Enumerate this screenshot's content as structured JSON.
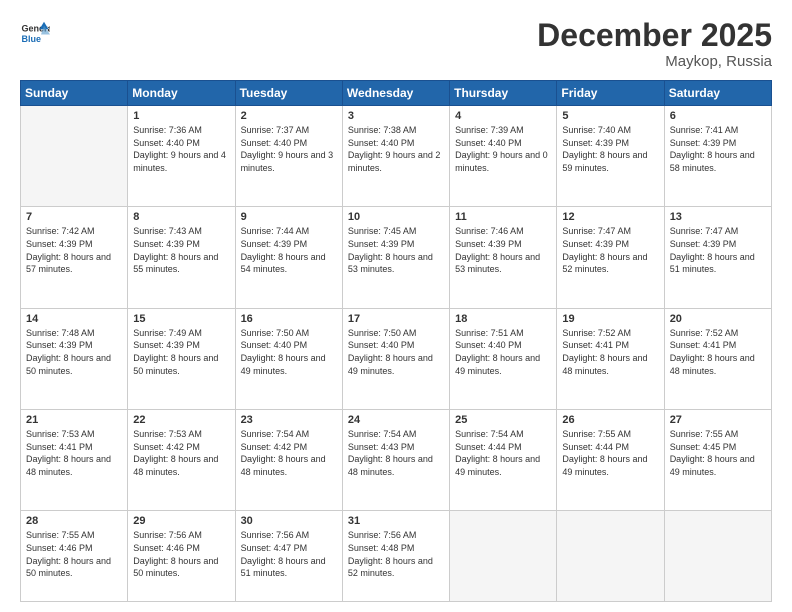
{
  "header": {
    "logo_general": "General",
    "logo_blue": "Blue",
    "month_title": "December 2025",
    "location": "Maykop, Russia"
  },
  "weekdays": [
    "Sunday",
    "Monday",
    "Tuesday",
    "Wednesday",
    "Thursday",
    "Friday",
    "Saturday"
  ],
  "weeks": [
    [
      {
        "day": "",
        "empty": true
      },
      {
        "day": "1",
        "sunrise": "7:36 AM",
        "sunset": "4:40 PM",
        "daylight": "9 hours and 4 minutes."
      },
      {
        "day": "2",
        "sunrise": "7:37 AM",
        "sunset": "4:40 PM",
        "daylight": "9 hours and 3 minutes."
      },
      {
        "day": "3",
        "sunrise": "7:38 AM",
        "sunset": "4:40 PM",
        "daylight": "9 hours and 2 minutes."
      },
      {
        "day": "4",
        "sunrise": "7:39 AM",
        "sunset": "4:40 PM",
        "daylight": "9 hours and 0 minutes."
      },
      {
        "day": "5",
        "sunrise": "7:40 AM",
        "sunset": "4:39 PM",
        "daylight": "8 hours and 59 minutes."
      },
      {
        "day": "6",
        "sunrise": "7:41 AM",
        "sunset": "4:39 PM",
        "daylight": "8 hours and 58 minutes."
      }
    ],
    [
      {
        "day": "7",
        "sunrise": "7:42 AM",
        "sunset": "4:39 PM",
        "daylight": "8 hours and 57 minutes."
      },
      {
        "day": "8",
        "sunrise": "7:43 AM",
        "sunset": "4:39 PM",
        "daylight": "8 hours and 55 minutes."
      },
      {
        "day": "9",
        "sunrise": "7:44 AM",
        "sunset": "4:39 PM",
        "daylight": "8 hours and 54 minutes."
      },
      {
        "day": "10",
        "sunrise": "7:45 AM",
        "sunset": "4:39 PM",
        "daylight": "8 hours and 53 minutes."
      },
      {
        "day": "11",
        "sunrise": "7:46 AM",
        "sunset": "4:39 PM",
        "daylight": "8 hours and 53 minutes."
      },
      {
        "day": "12",
        "sunrise": "7:47 AM",
        "sunset": "4:39 PM",
        "daylight": "8 hours and 52 minutes."
      },
      {
        "day": "13",
        "sunrise": "7:47 AM",
        "sunset": "4:39 PM",
        "daylight": "8 hours and 51 minutes."
      }
    ],
    [
      {
        "day": "14",
        "sunrise": "7:48 AM",
        "sunset": "4:39 PM",
        "daylight": "8 hours and 50 minutes."
      },
      {
        "day": "15",
        "sunrise": "7:49 AM",
        "sunset": "4:39 PM",
        "daylight": "8 hours and 50 minutes."
      },
      {
        "day": "16",
        "sunrise": "7:50 AM",
        "sunset": "4:40 PM",
        "daylight": "8 hours and 49 minutes."
      },
      {
        "day": "17",
        "sunrise": "7:50 AM",
        "sunset": "4:40 PM",
        "daylight": "8 hours and 49 minutes."
      },
      {
        "day": "18",
        "sunrise": "7:51 AM",
        "sunset": "4:40 PM",
        "daylight": "8 hours and 49 minutes."
      },
      {
        "day": "19",
        "sunrise": "7:52 AM",
        "sunset": "4:41 PM",
        "daylight": "8 hours and 48 minutes."
      },
      {
        "day": "20",
        "sunrise": "7:52 AM",
        "sunset": "4:41 PM",
        "daylight": "8 hours and 48 minutes."
      }
    ],
    [
      {
        "day": "21",
        "sunrise": "7:53 AM",
        "sunset": "4:41 PM",
        "daylight": "8 hours and 48 minutes."
      },
      {
        "day": "22",
        "sunrise": "7:53 AM",
        "sunset": "4:42 PM",
        "daylight": "8 hours and 48 minutes."
      },
      {
        "day": "23",
        "sunrise": "7:54 AM",
        "sunset": "4:42 PM",
        "daylight": "8 hours and 48 minutes."
      },
      {
        "day": "24",
        "sunrise": "7:54 AM",
        "sunset": "4:43 PM",
        "daylight": "8 hours and 48 minutes."
      },
      {
        "day": "25",
        "sunrise": "7:54 AM",
        "sunset": "4:44 PM",
        "daylight": "8 hours and 49 minutes."
      },
      {
        "day": "26",
        "sunrise": "7:55 AM",
        "sunset": "4:44 PM",
        "daylight": "8 hours and 49 minutes."
      },
      {
        "day": "27",
        "sunrise": "7:55 AM",
        "sunset": "4:45 PM",
        "daylight": "8 hours and 49 minutes."
      }
    ],
    [
      {
        "day": "28",
        "sunrise": "7:55 AM",
        "sunset": "4:46 PM",
        "daylight": "8 hours and 50 minutes."
      },
      {
        "day": "29",
        "sunrise": "7:56 AM",
        "sunset": "4:46 PM",
        "daylight": "8 hours and 50 minutes."
      },
      {
        "day": "30",
        "sunrise": "7:56 AM",
        "sunset": "4:47 PM",
        "daylight": "8 hours and 51 minutes."
      },
      {
        "day": "31",
        "sunrise": "7:56 AM",
        "sunset": "4:48 PM",
        "daylight": "8 hours and 52 minutes."
      },
      {
        "day": "",
        "empty": true
      },
      {
        "day": "",
        "empty": true
      },
      {
        "day": "",
        "empty": true
      }
    ]
  ]
}
